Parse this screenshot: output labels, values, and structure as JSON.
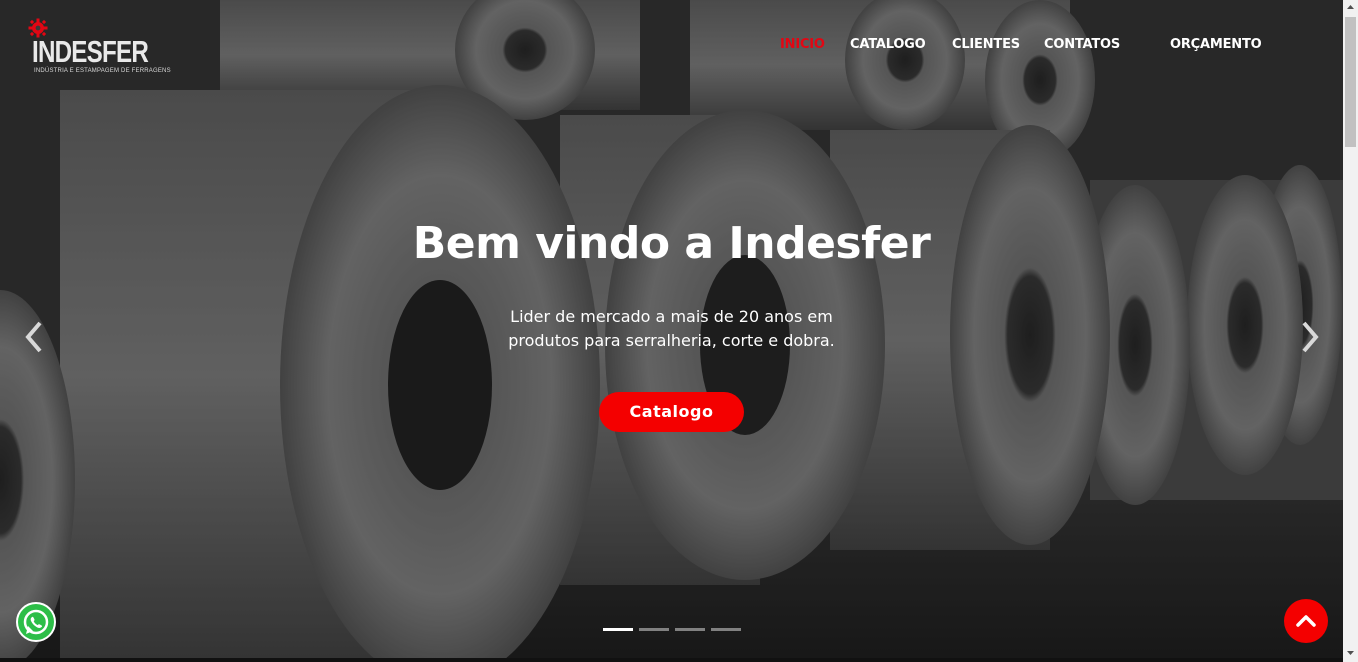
{
  "brand": {
    "name": "INDESFER",
    "tagline": "INDÚSTRIA E ESTAMPAGEM DE FERRAGENS",
    "icon": "gear-icon",
    "accent_color": "#e30613"
  },
  "nav": {
    "items": [
      {
        "label": "INICIO",
        "active": true
      },
      {
        "label": "CATALOGO",
        "active": false
      },
      {
        "label": "CLIENTES",
        "active": false
      },
      {
        "label": "CONTATOS",
        "active": false
      },
      {
        "label": "ORÇAMENTO",
        "active": false
      }
    ]
  },
  "hero": {
    "title": "Bem vindo a Indesfer",
    "subtitle_line1": "Lider de mercado a mais de 20 anos em",
    "subtitle_line2": "produtos para serralheria, corte e dobra.",
    "cta_label": "Catalogo",
    "cta_color": "#f40000",
    "prev_icon": "chevron-left-icon",
    "next_icon": "chevron-right-icon",
    "slides_total": 4,
    "slide_active": 1
  },
  "floating": {
    "whatsapp_icon": "whatsapp-icon",
    "whatsapp_color": "#2dbe48",
    "back_to_top_icon": "chevron-up-icon"
  }
}
